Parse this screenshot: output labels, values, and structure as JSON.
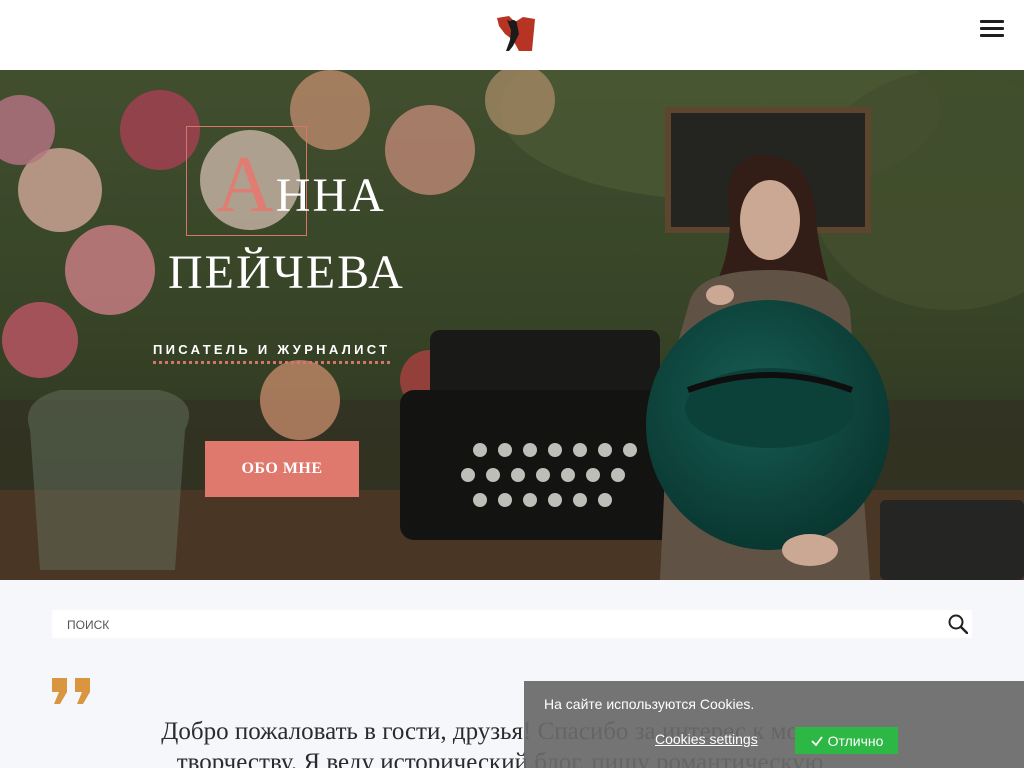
{
  "header": {
    "logo_icon": "author-silhouette-logo",
    "menu_icon": "hamburger-menu-icon"
  },
  "hero": {
    "name_first_initial": "А",
    "name_first_rest": "нна",
    "name_last": "Пейчева",
    "subtitle": "Писатель и журналист",
    "about_button": "Обо мне",
    "accent_color": "#df786d"
  },
  "search": {
    "placeholder": "поиск",
    "value": "",
    "icon": "search-icon"
  },
  "main": {
    "quote_icon": "quote-icon",
    "welcome_line1": "Добро пожаловать в гости, друзья! Спасибо за интерес к моему",
    "welcome_line2": "творчеству. Я веду исторический блог, пишу романтическую"
  },
  "cookie": {
    "message": "На сайте используются Cookies.",
    "settings_link": "Cookies settings",
    "ok_button": "Отлично",
    "ok_color": "#2db744"
  }
}
